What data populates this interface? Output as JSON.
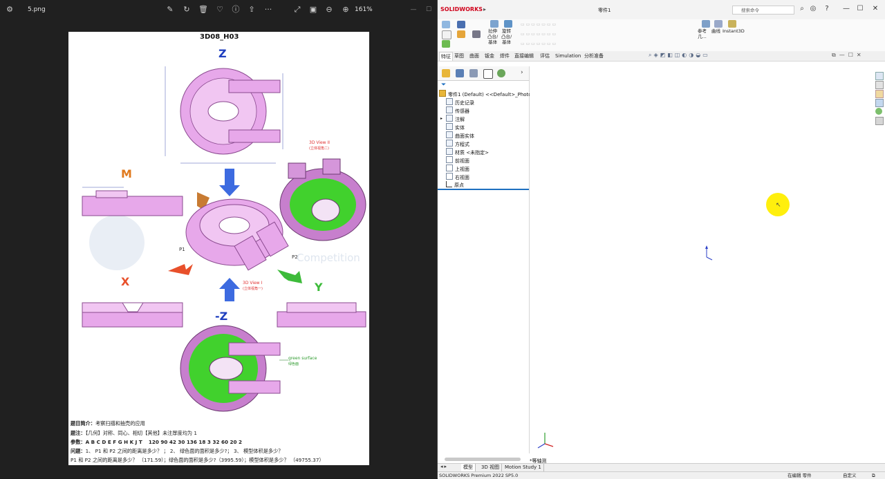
{
  "viewer": {
    "file_name": "5.png",
    "zoom": "161%"
  },
  "drawing": {
    "title": "3D08_H03",
    "axis_z": "Z",
    "axis_neg_z": "-Z",
    "axis_m": "M",
    "axis_x": "X",
    "axis_y": "Y",
    "view2_label": "3D View II",
    "view2_sub": "(立体视角二)",
    "view1_label": "3D View I",
    "view1_sub": "(立体视角一)",
    "p1": "P1",
    "p2": "P2",
    "green_label": "green surface",
    "green_sub": "绿色面",
    "watermark": "Competition",
    "desc_line1_label": "题目简介：",
    "desc_line1": "考察扫描和抽壳的应用",
    "desc_line2_label": "题注：",
    "desc_line2": "【几何】对称、同心、相切【其他】未注厚度均为 1",
    "desc_line3_label": "参数：",
    "desc_line3_letters": "A B C D E F G H K J T",
    "desc_line3_values": "120 90 42 30 136 18 3 32 60 20 2",
    "desc_line4_label": "问题：",
    "desc_line4": "1、 P1 和 P2 之间的距离是多少？ ；  2、 绿色面的面积是多少?；  3、 模型体积是多少？",
    "desc_line5": "P1 和 P2 之间的距离是多少？ （171.59）；绿色面的面积是多少?（3995.59）；模型体积是多少？ （49755.37）"
  },
  "solidworks": {
    "logo": "SOLIDWORKS",
    "doc_title": "零件1",
    "search_placeholder": "搜索命令",
    "ribbon": {
      "extrude": "拉伸\n凸台/\n基体",
      "revolve": "旋转\n凸台/\n基体",
      "ref_geo": "参考\n几...",
      "curves": "曲线",
      "instant3d": "Instant3D"
    },
    "tabs": [
      "特征",
      "草图",
      "曲面",
      "钣金",
      "焊件",
      "直接编辑",
      "评估",
      "Simulation",
      "分析准备"
    ],
    "tree_root": "零件1 (Default) <<Default>_Photo\\",
    "tree_items": [
      "历史记录",
      "传感器",
      "注解",
      "实体",
      "曲面实体",
      "方程式",
      "材质 <未指定>",
      "前视面",
      "上视面",
      "右视面",
      "原点"
    ],
    "view_name": "*等轴测",
    "bottom_tabs": [
      "模型",
      "3D 视图",
      "Motion Study 1"
    ],
    "status_left": "SOLIDWORKS Premium 2022 SP5.0",
    "status_mid": "在编辑 零件",
    "status_right": "自定义"
  }
}
